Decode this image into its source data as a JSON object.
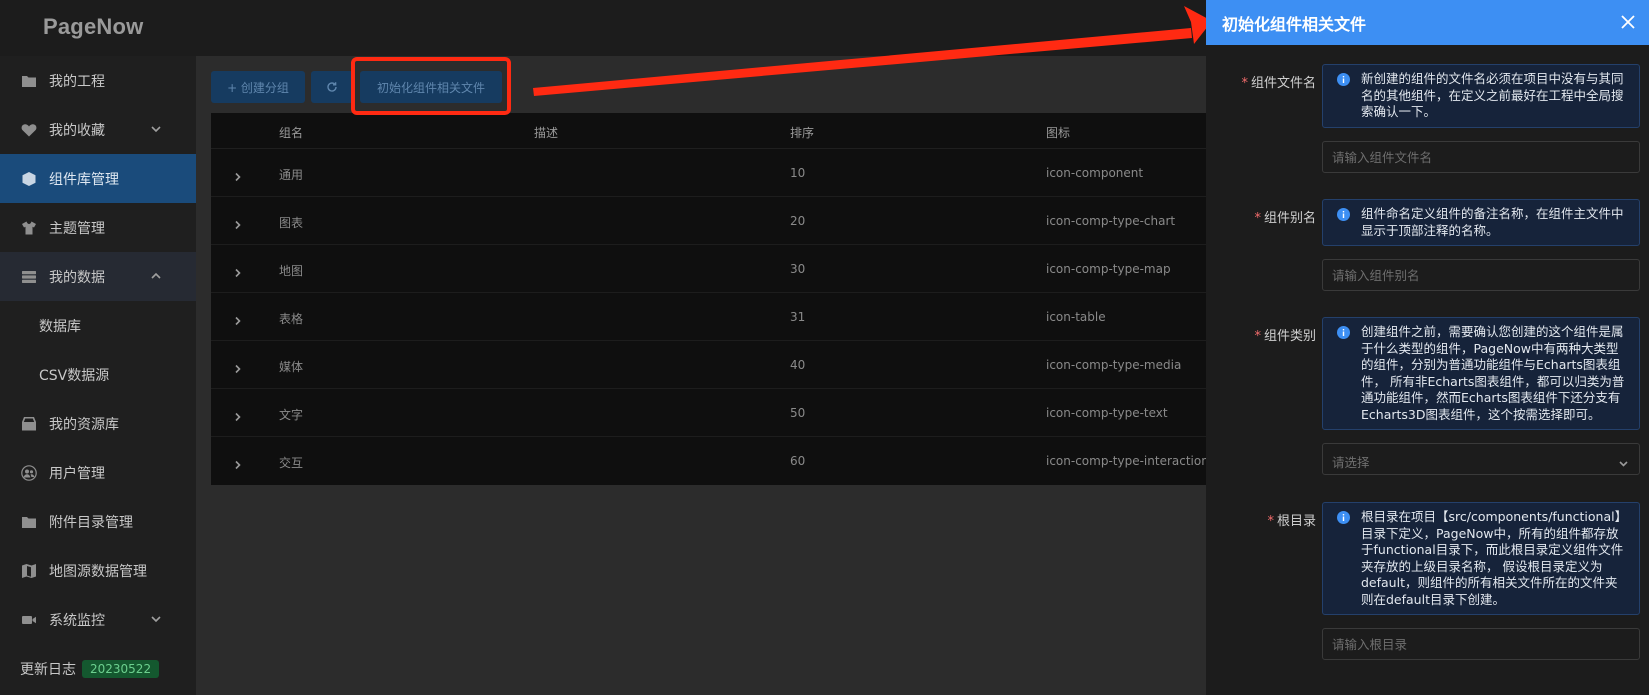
{
  "app": {
    "logo": "PageNow"
  },
  "sidebar": {
    "items": [
      {
        "label": "我的工程",
        "icon": "folder-icon"
      },
      {
        "label": "我的收藏",
        "icon": "heart-icon",
        "chevron": "down"
      },
      {
        "label": "组件库管理",
        "icon": "cube-icon",
        "active": true
      },
      {
        "label": "主题管理",
        "icon": "tshirt-icon"
      },
      {
        "label": "我的数据",
        "icon": "database-icon",
        "chevron": "up"
      },
      {
        "label": "数据库",
        "sub": true
      },
      {
        "label": "CSV数据源",
        "sub": true
      },
      {
        "label": "我的资源库",
        "icon": "archive-icon"
      },
      {
        "label": "用户管理",
        "icon": "users-icon"
      },
      {
        "label": "附件目录管理",
        "icon": "folder-icon"
      },
      {
        "label": "地图源数据管理",
        "icon": "map-icon"
      },
      {
        "label": "系统监控",
        "icon": "camera-icon",
        "chevron": "down"
      }
    ],
    "changelog": {
      "label": "更新日志",
      "version": "20230522"
    }
  },
  "toolbar": {
    "create_label": "+ 创建分组",
    "refresh_icon": "refresh-icon",
    "init_label": "初始化组件相关文件"
  },
  "table": {
    "columns": [
      "组名",
      "描述",
      "排序",
      "图标"
    ],
    "rows": [
      {
        "name": "通用",
        "desc": "",
        "order": "10",
        "icon": "icon-component"
      },
      {
        "name": "图表",
        "desc": "",
        "order": "20",
        "icon": "icon-comp-type-chart"
      },
      {
        "name": "地图",
        "desc": "",
        "order": "30",
        "icon": "icon-comp-type-map"
      },
      {
        "name": "表格",
        "desc": "",
        "order": "31",
        "icon": "icon-table"
      },
      {
        "name": "媒体",
        "desc": "",
        "order": "40",
        "icon": "icon-comp-type-media"
      },
      {
        "name": "文字",
        "desc": "",
        "order": "50",
        "icon": "icon-comp-type-text"
      },
      {
        "name": "交互",
        "desc": "",
        "order": "60",
        "icon": "icon-comp-type-interaction"
      }
    ]
  },
  "drawer": {
    "title": "初始化组件相关文件",
    "fields": [
      {
        "label": "组件文件名",
        "tip": "新创建的组件的文件名必须在项目中没有与其同名的其他组件，在定义之前最好在工程中全局搜索确认一下。",
        "placeholder": "请输入组件文件名"
      },
      {
        "label": "组件别名",
        "tip": "组件命名定义组件的备注名称，在组件主文件中显示于顶部注释的名称。",
        "placeholder": "请输入组件别名"
      },
      {
        "label": "组件类别",
        "tip": "创建组件之前，需要确认您创建的这个组件是属于什么类型的组件，PageNow中有两种大类型的组件，分别为普通功能组件与Echarts图表组件， 所有非Echarts图表组件，都可以归类为普通功能组件，然而Echarts图表组件下还分支有Echarts3D图表组件，这个按需选择即可。",
        "placeholder": "请选择"
      },
      {
        "label": "根目录",
        "tip": "根目录在项目【src/components/functional】目录下定义，PageNow中，所有的组件都存放于functional目录下，而此根目录定义组件文件夹存放的上级目录名称， 假设根目录定义为default，则组件的所有相关文件所在的文件夹则在default目录下创建。",
        "placeholder": "请输入根目录"
      }
    ]
  },
  "colors": {
    "accent": "#3d8ff3",
    "active_nav": "#1a4b7b",
    "annotation": "#ff2a12",
    "required": "#f56c6c"
  }
}
